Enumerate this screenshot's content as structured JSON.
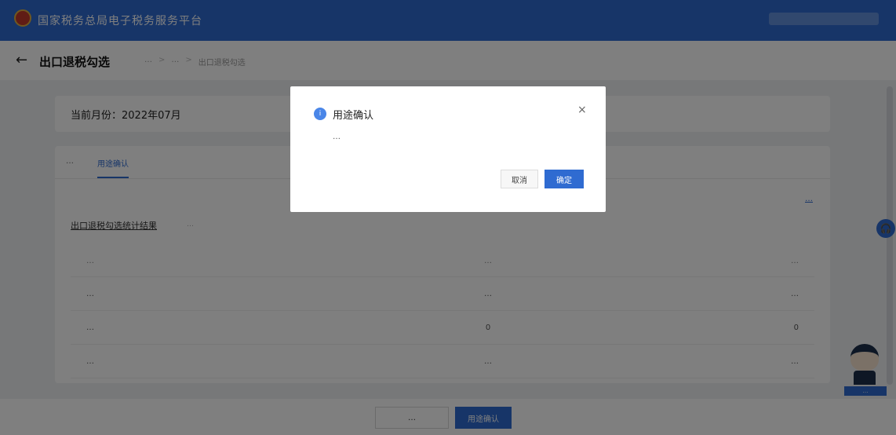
{
  "header": {
    "app_title": "国家税务总局电子税务服务平台"
  },
  "page": {
    "title": "出口退税勾选",
    "breadcrumb": [
      "…",
      "…",
      "出口退税勾选"
    ]
  },
  "period": {
    "label": "当前月份：2022年07月"
  },
  "tabs": [
    {
      "label": "…"
    },
    {
      "label": "用途确认",
      "active": true
    }
  ],
  "link_right": "…",
  "section": {
    "title": "出口退税勾选统计结果",
    "subtitle": "…"
  },
  "table": {
    "headers": [
      "…",
      "…",
      "…"
    ],
    "rows": [
      [
        "…",
        "…",
        "…"
      ],
      [
        "…",
        "0",
        "0"
      ],
      [
        "…",
        "…",
        "…"
      ]
    ]
  },
  "bottom": {
    "download_label": "…",
    "purpose_label": "用途确认"
  },
  "assistant": {
    "label": "…"
  },
  "dialog": {
    "title": "用途确认",
    "message": "…",
    "cancel_label": "取消",
    "confirm_label": "确定",
    "close_symbol": "×"
  },
  "colors": {
    "primary": "#2f6bd1",
    "overlay": "rgba(0,0,0,0.5)"
  },
  "icons": [
    "arrow-left-icon",
    "info-icon",
    "close-icon",
    "headset-icon"
  ]
}
